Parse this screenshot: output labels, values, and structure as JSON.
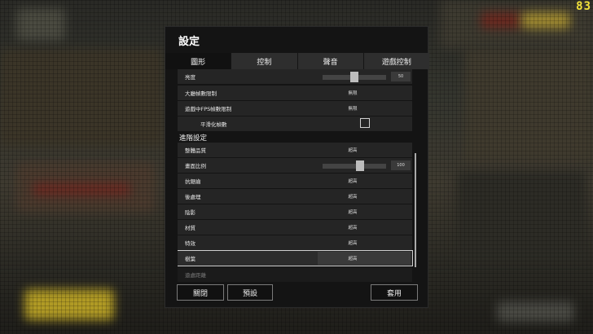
{
  "hud": {
    "fps": "83"
  },
  "dialog": {
    "title": "設定",
    "tabs": [
      {
        "label": "圖形",
        "active": true
      },
      {
        "label": "控制",
        "active": false
      },
      {
        "label": "聲音",
        "active": false
      },
      {
        "label": "遊戲控制",
        "active": false
      }
    ],
    "settings": {
      "brightness": {
        "label": "亮度",
        "value": "50",
        "level": 0.5
      },
      "lobby_fps_limit": {
        "label": "大廳幀數限制",
        "value": "無限"
      },
      "ingame_fps_limit": {
        "label": "遊戲中FPS幀數限制",
        "value": "無限"
      },
      "smooth_framerate": {
        "label": "平滑化幀數",
        "checked": false
      },
      "advanced_header": "進階設定",
      "overall_quality": {
        "label": "整體品質",
        "value": "超高"
      },
      "screen_scale": {
        "label": "畫面比例",
        "value": "100",
        "level": 0.6
      },
      "anti_aliasing": {
        "label": "抗鋸齒",
        "value": "超高"
      },
      "post_processing": {
        "label": "後處理",
        "value": "超高"
      },
      "shadows": {
        "label": "陰影",
        "value": "超高"
      },
      "textures": {
        "label": "材質",
        "value": "超高"
      },
      "effects": {
        "label": "特效",
        "value": "超高"
      },
      "foliage": {
        "label": "樹葉",
        "value": "超高"
      },
      "view_distance": {
        "label": "遠處距離"
      }
    },
    "buttons": {
      "close": "關閉",
      "default": "預設",
      "apply": "套用"
    }
  }
}
